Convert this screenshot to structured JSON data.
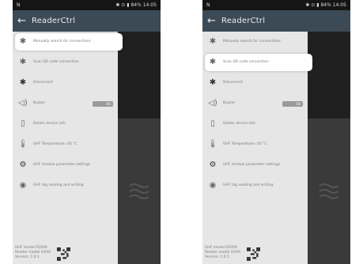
{
  "statusbar": {
    "left": "N",
    "right": "✱ ⊙ ▮ 84% 14:05"
  },
  "app": {
    "title": "ReaderCtrl",
    "back_icon": "arrow-left-icon"
  },
  "menu": [
    {
      "icon": "bluetooth-search-icon",
      "label": "Manually search for connections"
    },
    {
      "icon": "bluetooth-qr-icon",
      "label": "Scan QR code connection"
    },
    {
      "icon": "bluetooth-disconnect-icon",
      "label": "Disconnect"
    },
    {
      "icon": "speaker-icon",
      "label": "Buzzer",
      "toggle": "ON"
    },
    {
      "icon": "document-icon",
      "label": "Delete device info"
    },
    {
      "icon": "thermometer-icon",
      "label": "UHF Temperature=16 °C"
    },
    {
      "icon": "gear-icon",
      "label": "UHF module parameter settings"
    },
    {
      "icon": "tag-icon",
      "label": "UHF tag reading and writing"
    }
  ],
  "footer": {
    "line1": "UHF model R2000",
    "line2": "Reader model XXXX",
    "line3": "Version: 1.0.1"
  },
  "colors": {
    "appbar": "#3c4a56",
    "drawer": "#e6e6e6",
    "highlight": "#ffffff"
  }
}
